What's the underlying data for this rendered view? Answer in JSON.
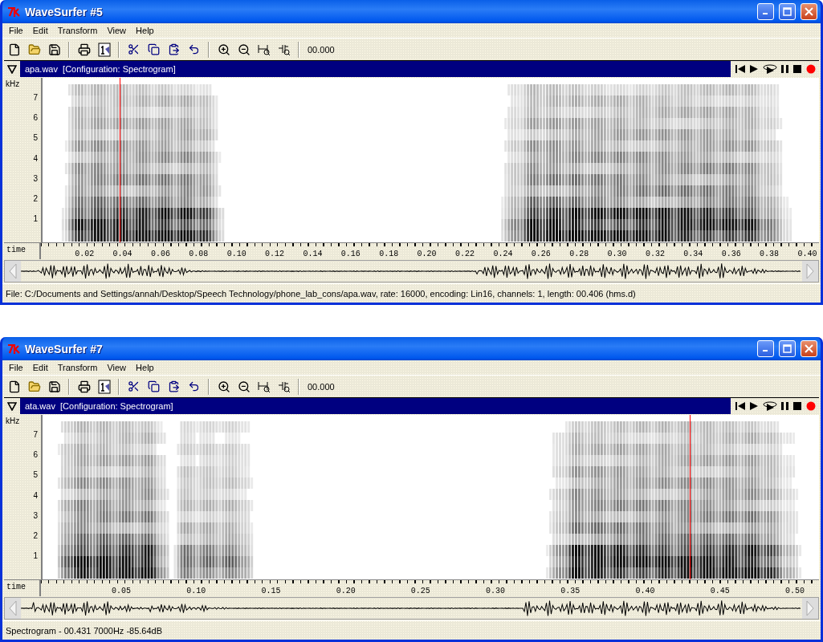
{
  "windows": [
    {
      "title": "WaveSurfer #5",
      "menu": [
        "File",
        "Edit",
        "Transform",
        "View",
        "Help"
      ],
      "time_display": "00.000",
      "pane": {
        "file": "apa.wav",
        "configuration": "[Configuration: Spectrogram]",
        "freq_axis_label": "kHz",
        "freq_ticks": [
          "7",
          "6",
          "5",
          "4",
          "3",
          "2",
          "1"
        ],
        "time_axis_label": "time",
        "time_ticks": [
          "0.02",
          "0.04",
          "0.06",
          "0.08",
          "0.10",
          "0.12",
          "0.14",
          "0.16",
          "0.18",
          "0.20",
          "0.22",
          "0.24",
          "0.26",
          "0.28",
          "0.30",
          "0.32",
          "0.34",
          "0.36",
          "0.38",
          "0.40"
        ],
        "cursor": {
          "level": 0.099
        }
      },
      "status_bar": "File: C:/Documents and Settings/annah/Desktop/Speech Technology/phone_lab_cons/apa.wav, rate: 16000, encoding: Lin16, channels: 1, length: 00.406 (hms.d)"
    },
    {
      "title": "WaveSurfer #7",
      "menu": [
        "File",
        "Edit",
        "Transform",
        "View",
        "Help"
      ],
      "time_display": "00.000",
      "pane": {
        "file": "ata.wav",
        "configuration": "[Configuration: Spectrogram]",
        "freq_axis_label": "kHz",
        "freq_ticks": [
          "7",
          "6",
          "5",
          "4",
          "3",
          "2",
          "1"
        ],
        "time_axis_label": "time",
        "time_ticks": [
          "0.05",
          "0.10",
          "0.15",
          "0.20",
          "0.25",
          "0.30",
          "0.35",
          "0.40",
          "0.45",
          "0.50"
        ],
        "cursor": {
          "level": 0.833
        }
      },
      "status_bar": "Spectrogram - 00.431 7000Hz -85.64dB"
    }
  ]
}
